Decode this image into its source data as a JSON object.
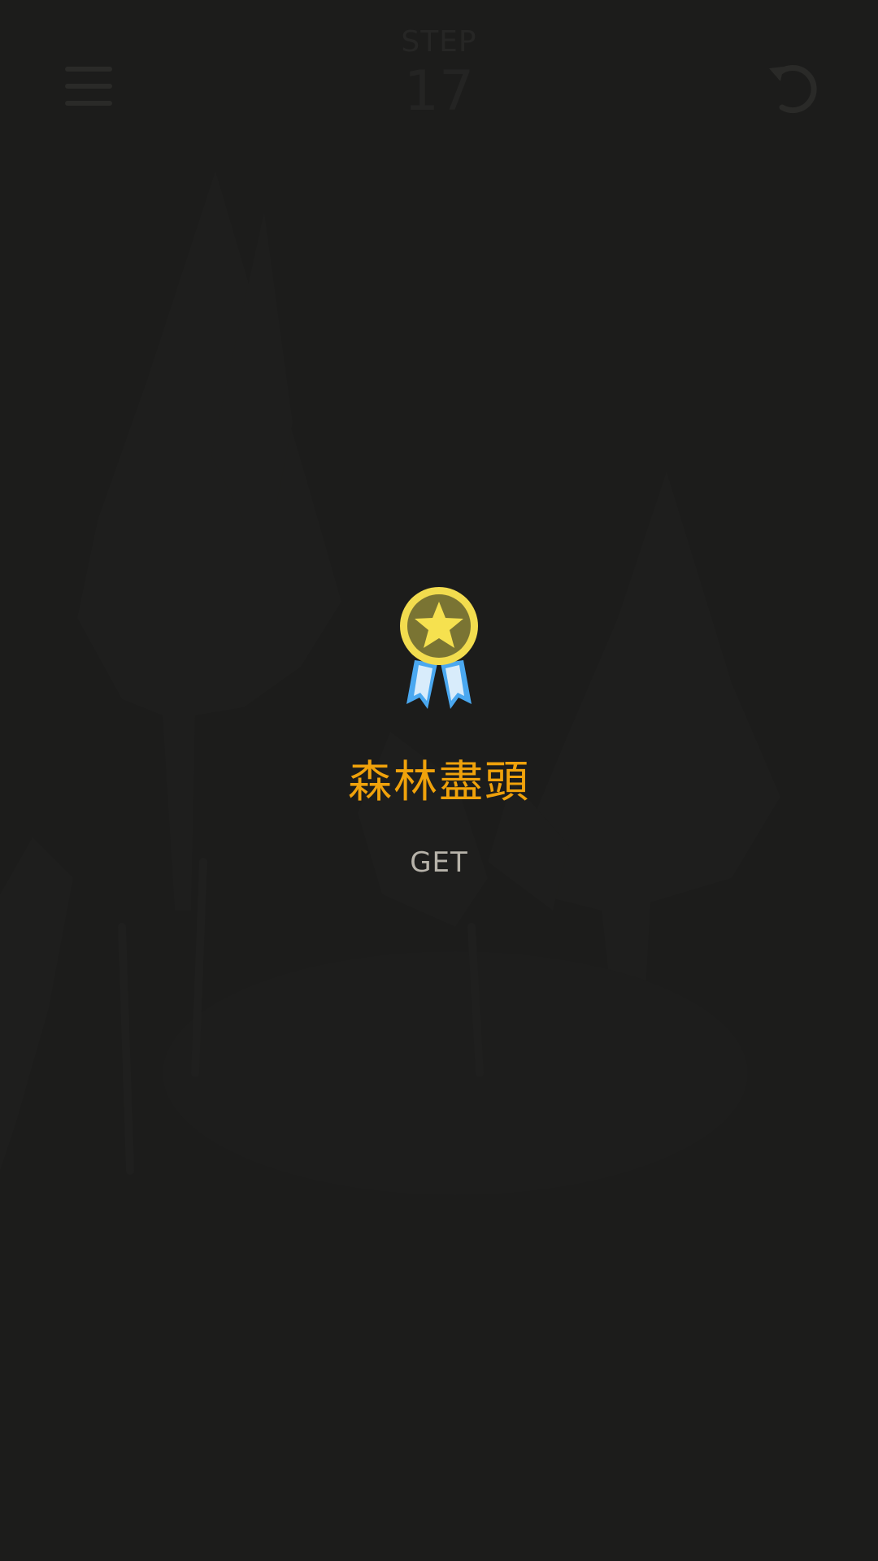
{
  "colors": {
    "background": "#1c1c1b",
    "title": "#f0a20b",
    "status": "#b7b3aa",
    "medal_gold": "#f2dc4e",
    "medal_ribbon": "#4aa8f0"
  },
  "header": {
    "menu_icon": "hamburger-menu-icon",
    "step_label": "STEP",
    "step_value": "17",
    "undo_icon": "undo-arrow-icon"
  },
  "achievement": {
    "icon": "medal-star-icon",
    "title": "森林盡頭",
    "status": "GET"
  }
}
